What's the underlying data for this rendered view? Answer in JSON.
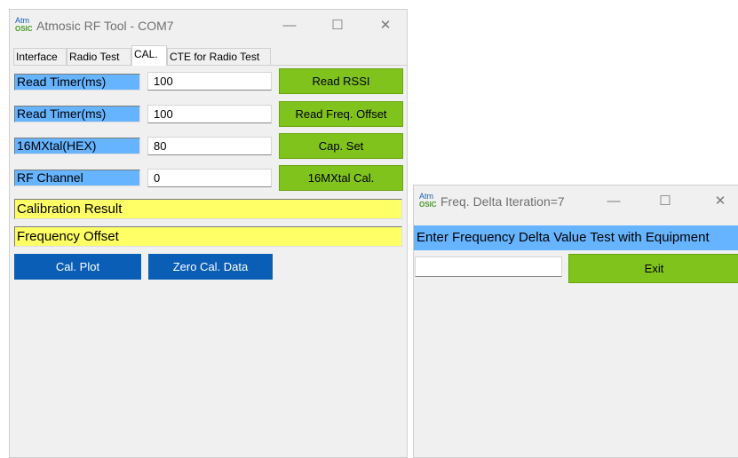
{
  "main_window": {
    "logo": {
      "line1": "Atm",
      "line2": "OSIC"
    },
    "title": "Atmosic RF Tool - COM7",
    "controls": {
      "minimize": "—",
      "maximize": "☐",
      "close": "✕"
    },
    "tabs": [
      "Interface",
      "Radio Test",
      "CAL.",
      "CTE for Radio Test"
    ],
    "active_tab": "CAL.",
    "rows": [
      {
        "label": "Read Timer(ms)",
        "value": "100",
        "button": "Read RSSI"
      },
      {
        "label": "Read Timer(ms)",
        "value": "100",
        "button": "Read Freq. Offset"
      },
      {
        "label": "16MXtal(HEX)",
        "value": "80",
        "button": "Cap. Set"
      },
      {
        "label": "RF Channel",
        "value": "0",
        "button": "16MXtal Cal."
      }
    ],
    "calibration_result_label": "Calibration Result",
    "frequency_offset_label": "Frequency Offset",
    "cal_plot_button": "Cal. Plot",
    "zero_cal_data_button": "Zero Cal. Data"
  },
  "dialog": {
    "logo": {
      "line1": "Atm",
      "line2": "OSIC"
    },
    "title": "Freq. Delta Iteration=7",
    "controls": {
      "minimize": "—",
      "maximize": "☐",
      "close": "✕"
    },
    "prompt": "Enter Frequency Delta Value Test with Equipment",
    "input_value": "",
    "exit_button": "Exit"
  },
  "colors": {
    "label_blue": "#66b3ff",
    "label_yellow": "#ffff66",
    "button_green": "#7fc31c",
    "button_blue": "#0a5eb5"
  }
}
